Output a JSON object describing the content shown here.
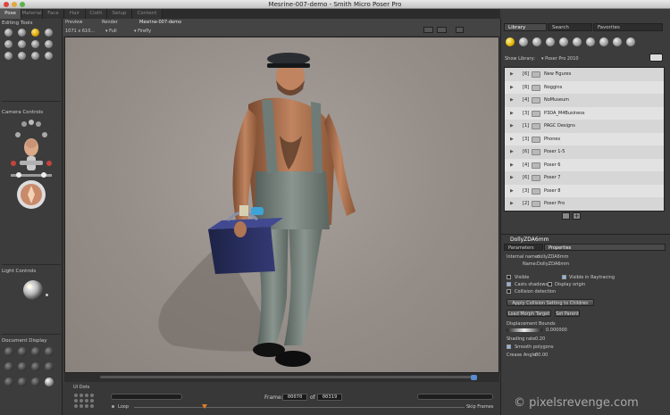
{
  "window": {
    "title": "Mesrine-007-demo - Smith Micro Poser Pro"
  },
  "rooms": [
    "Pose",
    "Material",
    "Face",
    "Hair",
    "Cloth",
    "Setup",
    "Content"
  ],
  "left_panel": {
    "editing_tools": "Editing Tools",
    "camera_controls": "Camera Controls",
    "light_controls": "Light Controls",
    "document_display": "Document Display",
    "ui_dots": "UI Dots"
  },
  "viewport": {
    "tabs": [
      "Preview",
      "Render"
    ],
    "document_name": "Mesrine-007-demo",
    "size": "1071 x 610...",
    "fit": "Full",
    "style": "Firefly"
  },
  "timeline": {
    "frame_label": "Frame:",
    "current_frame": "00070",
    "of_label": "of",
    "total_frames": "00319",
    "loop_label": "Loop",
    "skip_frames_label": "Skip Frames"
  },
  "library": {
    "tabs": [
      "Library",
      "Search",
      "Favorites"
    ],
    "show_library_label": "Show Library:",
    "show_library_value": "Poser Pro 2010",
    "items": [
      {
        "count": "[6]",
        "name": "New Figures"
      },
      {
        "count": "[8]",
        "name": "Noggins"
      },
      {
        "count": "[4]",
        "name": "NoMuseum"
      },
      {
        "count": "[3]",
        "name": "P3DA_M4Business"
      },
      {
        "count": "[1]",
        "name": "PAGC Designs"
      },
      {
        "count": "[3]",
        "name": "Phones"
      },
      {
        "count": "[6]",
        "name": "Poser 1-5"
      },
      {
        "count": "[4]",
        "name": "Poser 6"
      },
      {
        "count": "[6]",
        "name": "Poser 7"
      },
      {
        "count": "[3]",
        "name": "Poser 8"
      },
      {
        "count": "[2]",
        "name": "Poser Pro"
      }
    ]
  },
  "properties": {
    "object_name": "DollyZDA6mm",
    "tabs": [
      "Parameters",
      "Properties"
    ],
    "internal_name_label": "Internal name:",
    "internal_name_value": "dollyZDA6mm",
    "name_label": "Name:",
    "name_value": "DollyZDA6mm",
    "visible": "Visible",
    "visible_in_raytracing": "Visible in Raytracing",
    "casts_shadows": "Casts shadows",
    "display_origin": "Display origin",
    "collision_detection": "Collision detection",
    "apply_collision": "Apply Collision Setting to Children",
    "load_morph_target": "Load Morph Target",
    "set_parent": "Set Parent",
    "displacement_bounds_label": "Displacement Bounds",
    "displacement_bounds_value": "0.000000",
    "shading_rate_label": "Shading rate",
    "shading_rate_value": "0.20",
    "smooth_polygons": "Smooth polygons",
    "crease_angle_label": "Crease Angle",
    "crease_angle_value": "80.00"
  },
  "watermark": "© pixelsrevenge.com",
  "colors": {
    "accent": "#e3b300",
    "viewport_bg": "#958d88",
    "panel": "#3c3c3c"
  }
}
